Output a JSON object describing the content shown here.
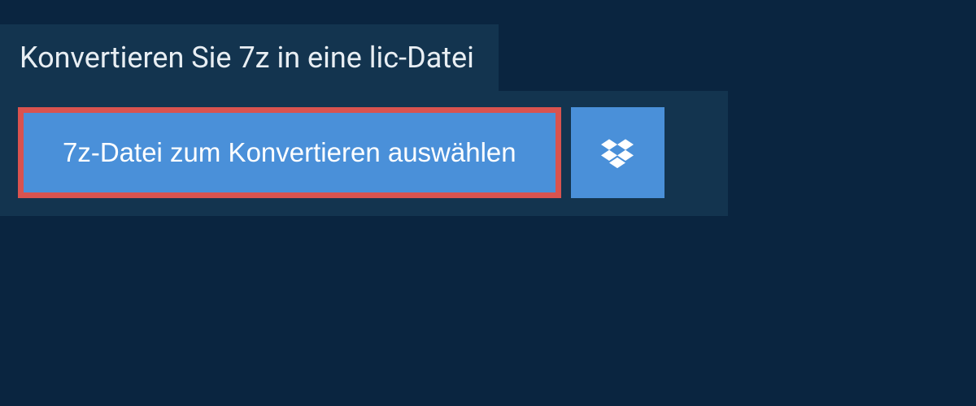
{
  "header": {
    "title": "Konvertieren Sie 7z in eine lic-Datei"
  },
  "actions": {
    "select_file_label": "7z-Datei zum Konvertieren auswählen",
    "dropbox_icon_name": "dropbox-icon"
  },
  "colors": {
    "background": "#0a2540",
    "panel": "#13344f",
    "button": "#4a90d9",
    "highlight_border": "#d9534f",
    "text_light": "#e8eef3"
  }
}
